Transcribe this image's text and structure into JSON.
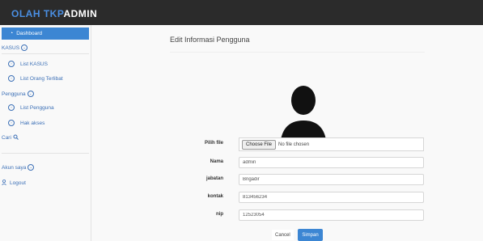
{
  "brand": {
    "part1": "OLAH TKP",
    "part2": "ADMIN"
  },
  "sidebar": {
    "dashboard": "Dashboard",
    "kasus": "KASUS",
    "list_kasus": "List KASUS",
    "list_orang": "List Orang Terlibat",
    "pengguna": "Pengguna",
    "list_pengguna": "List Pengguna",
    "hak_akses": "Hak akses",
    "cari": "Cari",
    "akun_saya": "Akun saya",
    "logout": "Logout"
  },
  "page": {
    "title": "Edit Informasi Pengguna"
  },
  "form": {
    "file_label": "Pilih file",
    "file_button": "Choose File",
    "file_status": "No file chosen",
    "nama_label": "Nama",
    "nama_value": "admin",
    "jabatan_label": "jabatan",
    "jabatan_value": "Brigadir",
    "kontak_label": "kontak",
    "kontak_value": "813456234",
    "nip_label": "nip",
    "nip_value": "12523054",
    "cancel": "Cancel",
    "save": "Simpan"
  },
  "colors": {
    "accent": "#3c86d3",
    "topbar": "#2b2b2b",
    "brand_blue": "#4a8fe3"
  },
  "icons": {
    "dashboard": "dashboard-icon",
    "toggle": "chevron-circle-icon",
    "item": "circle-icon",
    "search": "search-icon",
    "user": "user-icon",
    "avatar": "user-avatar-icon"
  }
}
